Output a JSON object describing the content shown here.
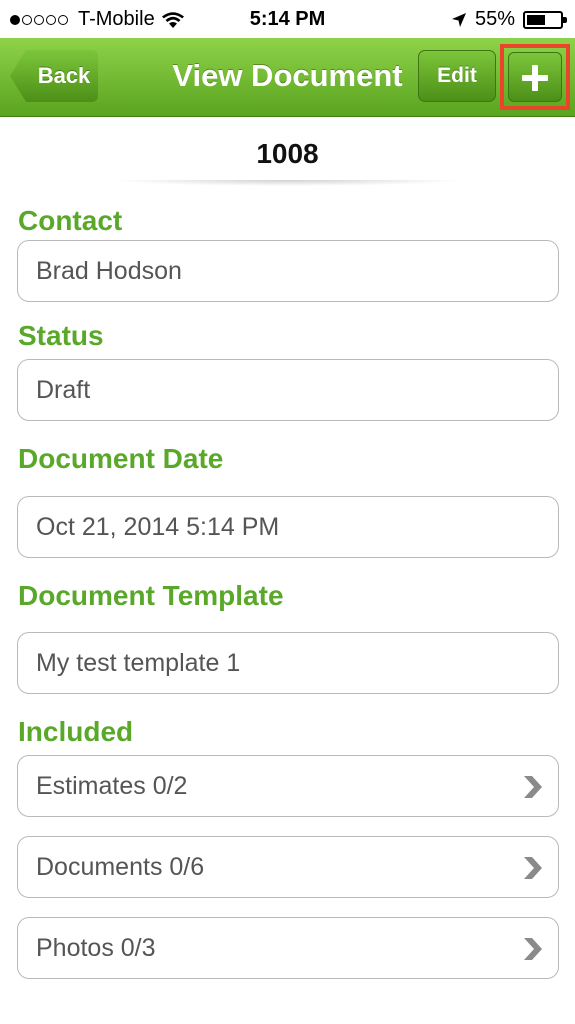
{
  "status_bar": {
    "carrier": "T-Mobile",
    "time": "5:14 PM",
    "battery": "55%",
    "battery_level": 0.55,
    "signal_bars_filled": 1,
    "signal_bars_total": 5,
    "icons": [
      "signal-dots-icon",
      "wifi-icon",
      "location-arrow-icon",
      "battery-icon"
    ]
  },
  "navbar": {
    "title": "View Document",
    "back_label": "Back",
    "edit_label": "Edit",
    "add_icon": "plus-icon",
    "highlight_color": "#e8452a",
    "bar_color": "#6fba2c"
  },
  "document": {
    "number": "1008"
  },
  "fields": {
    "contact": {
      "label": "Contact",
      "value": "Brad Hodson"
    },
    "status": {
      "label": "Status",
      "value": "Draft"
    },
    "document_date": {
      "label": "Document Date",
      "value": "Oct 21, 2014 5:14 PM"
    },
    "document_template": {
      "label": "Document Template",
      "value": "My test template 1"
    }
  },
  "included": {
    "label": "Included",
    "items": [
      {
        "label": "Estimates 0/2",
        "icon": "chevron-right-icon"
      },
      {
        "label": "Documents 0/6",
        "icon": "chevron-right-icon"
      },
      {
        "label": "Photos 0/3",
        "icon": "chevron-right-icon"
      }
    ]
  },
  "colors": {
    "accent_green": "#5aa82a"
  }
}
